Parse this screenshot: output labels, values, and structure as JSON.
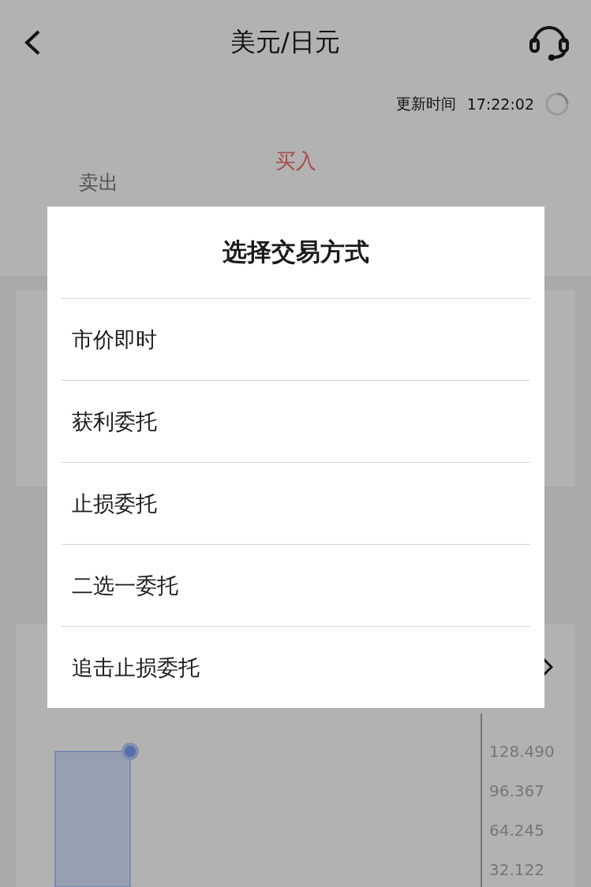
{
  "header": {
    "title": "美元/日元"
  },
  "update": {
    "label": "更新时间",
    "time": "17:22:02"
  },
  "quote": {
    "sell_label": "卖出",
    "buy_label": "买入"
  },
  "chart": {
    "axis_labels": [
      "128.490",
      "96.367",
      "64.245",
      "32.122"
    ]
  },
  "dialog": {
    "title": "选择交易方式",
    "options": [
      "市价即时",
      "获利委托",
      "止损委托",
      "二选一委托",
      "追击止损委托"
    ]
  }
}
